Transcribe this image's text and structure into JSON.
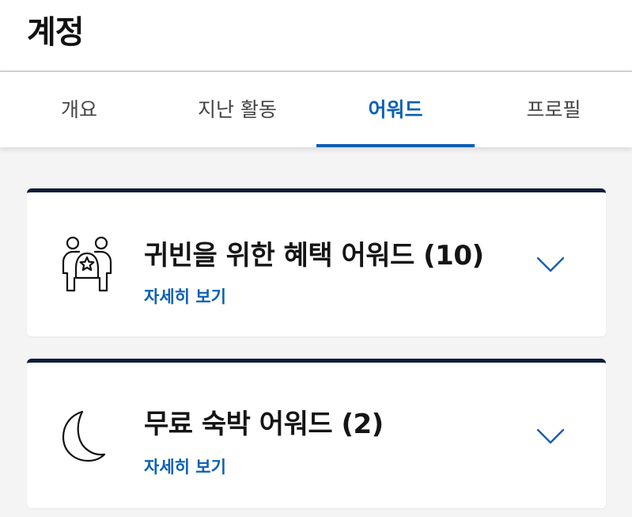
{
  "header": {
    "title": "계정"
  },
  "tabs": [
    {
      "label": "개요",
      "active": false
    },
    {
      "label": "지난 활동",
      "active": false
    },
    {
      "label": "어워드",
      "active": true
    },
    {
      "label": "프로필",
      "active": false
    }
  ],
  "cards": [
    {
      "icon": "people-star-icon",
      "title": "귀빈을 위한 혜택 어워드 (10)",
      "link": "자세히 보기"
    },
    {
      "icon": "moon-icon",
      "title": "무료 숙박 어워드 (2)",
      "link": "자세히 보기"
    }
  ],
  "colors": {
    "accent": "#0a5fb4",
    "card_border": "#0f1b3d",
    "background": "#f4f4f4"
  }
}
